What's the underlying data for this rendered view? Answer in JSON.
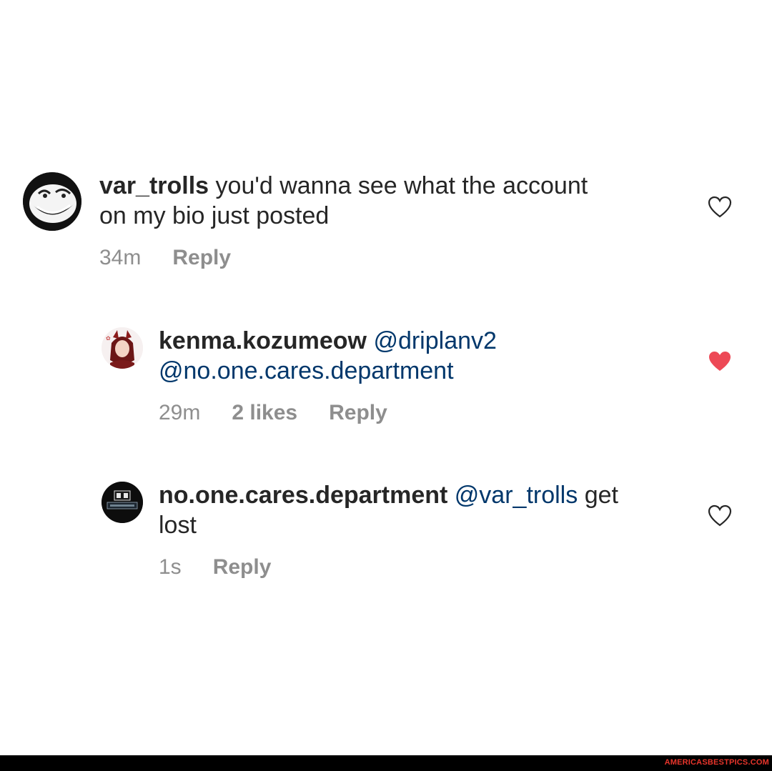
{
  "comments": [
    {
      "username": "var_trolls",
      "text_line1": "you'd wanna see what the account",
      "text_line2": "on my bio just posted",
      "time": "34m",
      "reply": "Reply",
      "liked": false
    },
    {
      "username": "kenma.kozumeow",
      "mention1": "@driplanv2",
      "mention2": "@no.one.cares.department",
      "time": "29m",
      "likes": "2 likes",
      "reply": "Reply",
      "liked": true
    },
    {
      "username": "no.one.cares.department",
      "mention1": "@var_trolls",
      "text_after": "get",
      "text_line2": "lost",
      "time": "1s",
      "reply": "Reply",
      "liked": false
    }
  ],
  "footer": {
    "brand": "AMERICASBESTPICS.COM"
  },
  "colors": {
    "heart_liked": "#ed4956",
    "mention": "#00376b",
    "meta": "#8e8e8e"
  },
  "icons": [
    "heart-outline-icon",
    "heart-filled-icon"
  ]
}
